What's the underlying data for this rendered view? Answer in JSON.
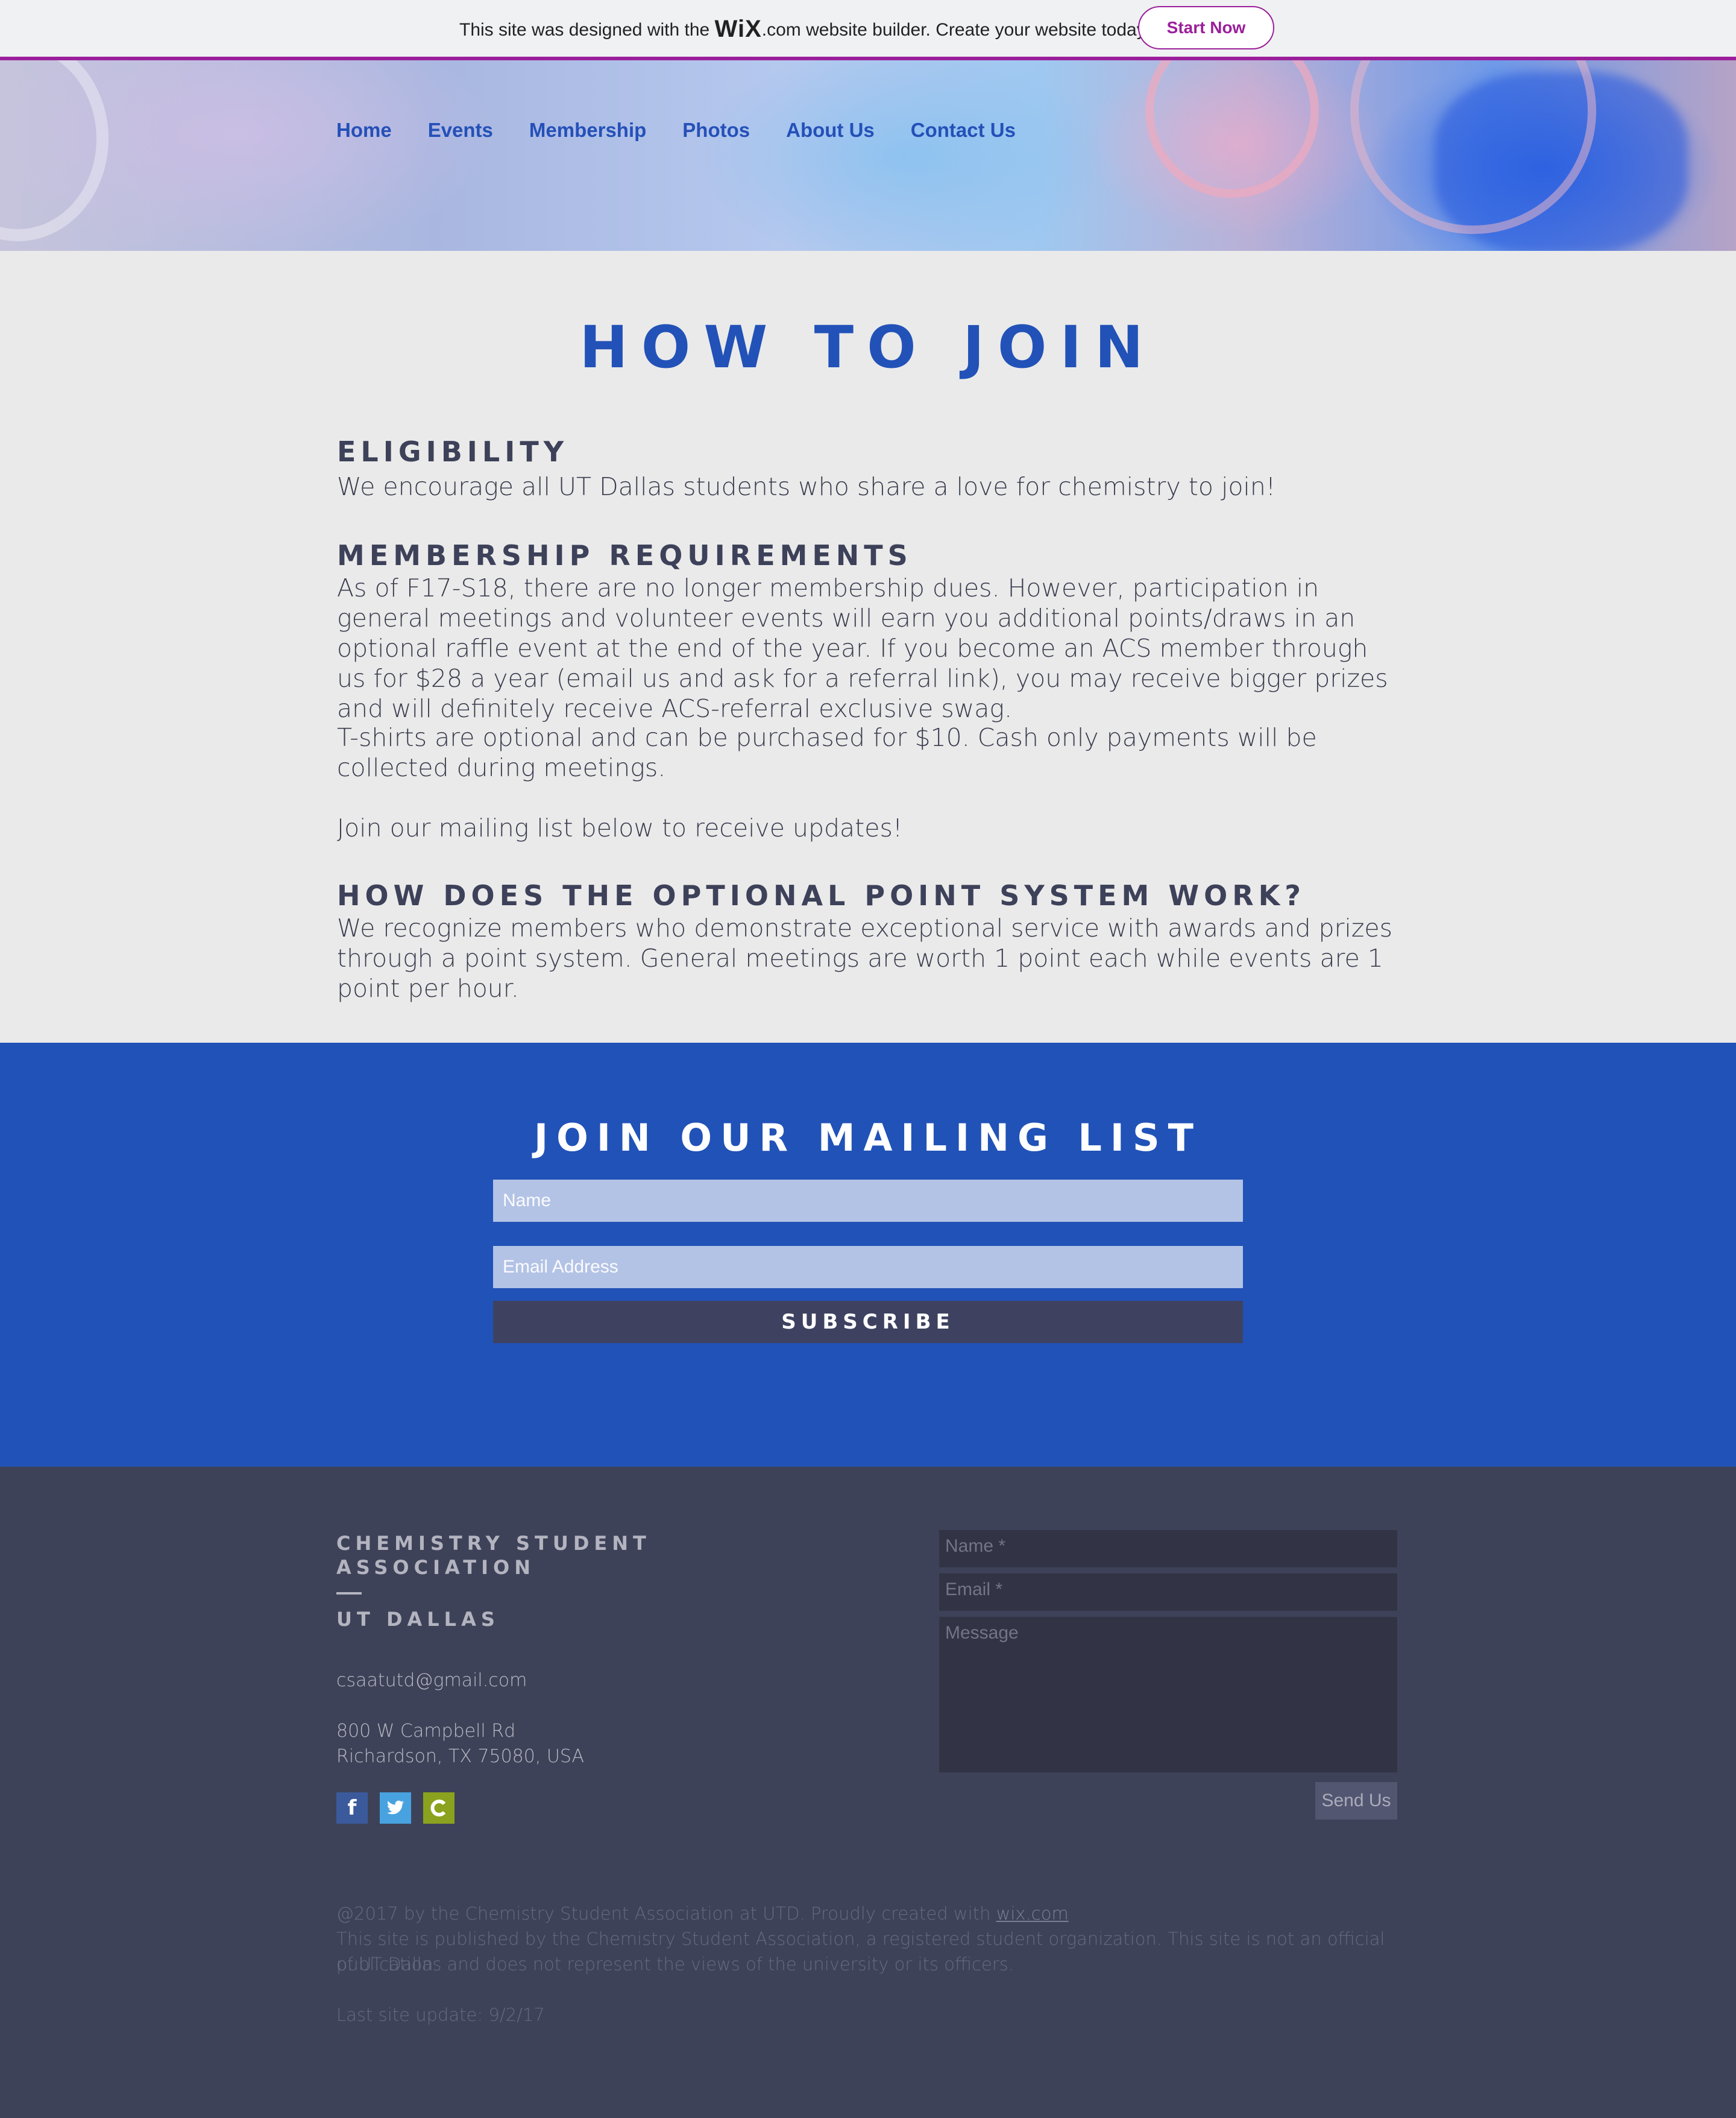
{
  "wix_banner": {
    "text_before": "This site was designed with the ",
    "logo": "WiX",
    "text_after": ".com website builder. Create your website today.",
    "button": "Start Now",
    "accent_color": "#9b1f9b"
  },
  "nav": {
    "items": [
      "Home",
      "Events",
      "Membership",
      "Photos",
      "About Us",
      "Contact Us"
    ]
  },
  "page": {
    "title": "HOW TO JOIN",
    "sections": [
      {
        "heading": "ELIGIBILITY",
        "paragraphs": [
          "We encourage all UT Dallas students who share a love for chemistry to join!"
        ]
      },
      {
        "heading": "MEMBERSHIP REQUIREMENTS",
        "paragraphs": [
          "As of F17-S18, there are no longer membership dues. However, participation in general meetings and volunteer events will earn you additional points/draws in an optional raffle event at the end of the year. If you become an ACS member through us for $28 a year (email us and ask for a referral link), you may receive bigger prizes and will definitely receive ACS-referral exclusive swag.",
          "T-shirts are optional and can be purchased for $10. Cash only payments will be collected during meetings.",
          "Join our mailing list below to receive updates!"
        ]
      },
      {
        "heading": "HOW DOES THE OPTIONAL POINT SYSTEM WORK?",
        "paragraphs": [
          "We recognize members who demonstrate exceptional service with awards and prizes through a point system. General meetings are worth 1 point each while events are 1 point per hour."
        ]
      }
    ]
  },
  "mailing_list": {
    "title": "JOIN OUR MAILING LIST",
    "name_placeholder": "Name",
    "email_placeholder": "Email Address",
    "button": "SUBSCRIBE",
    "bg_color": "#2152b7"
  },
  "footer": {
    "org_line1": "CHEMISTRY STUDENT",
    "org_line2": "ASSOCIATION",
    "org_line3": "UT DALLAS",
    "email": "csaatutd@gmail.com",
    "address_line1": "800 W Campbell Rd",
    "address_line2": "Richardson, TX 75080, USA",
    "social": [
      "facebook-icon",
      "twitter-icon",
      "calendar-icon"
    ],
    "contact_form": {
      "name_placeholder": "Name *",
      "email_placeholder": "Email *",
      "message_placeholder": "Message",
      "button": "Send Us"
    },
    "copyright_text": "@2017 by the Chemistry Student Association at UTD. Proudly created with ",
    "copyright_link": "wix.com",
    "disclaimer_line1": "This site is published by the Chemistry Student Association, a registered student organization. This site is not an official publication",
    "disclaimer_line2": "of UT Dallas and does not represent the views of the university or its officers.",
    "last_update": "Last site update: 9/2/17",
    "bg_color": "#3e4259"
  }
}
